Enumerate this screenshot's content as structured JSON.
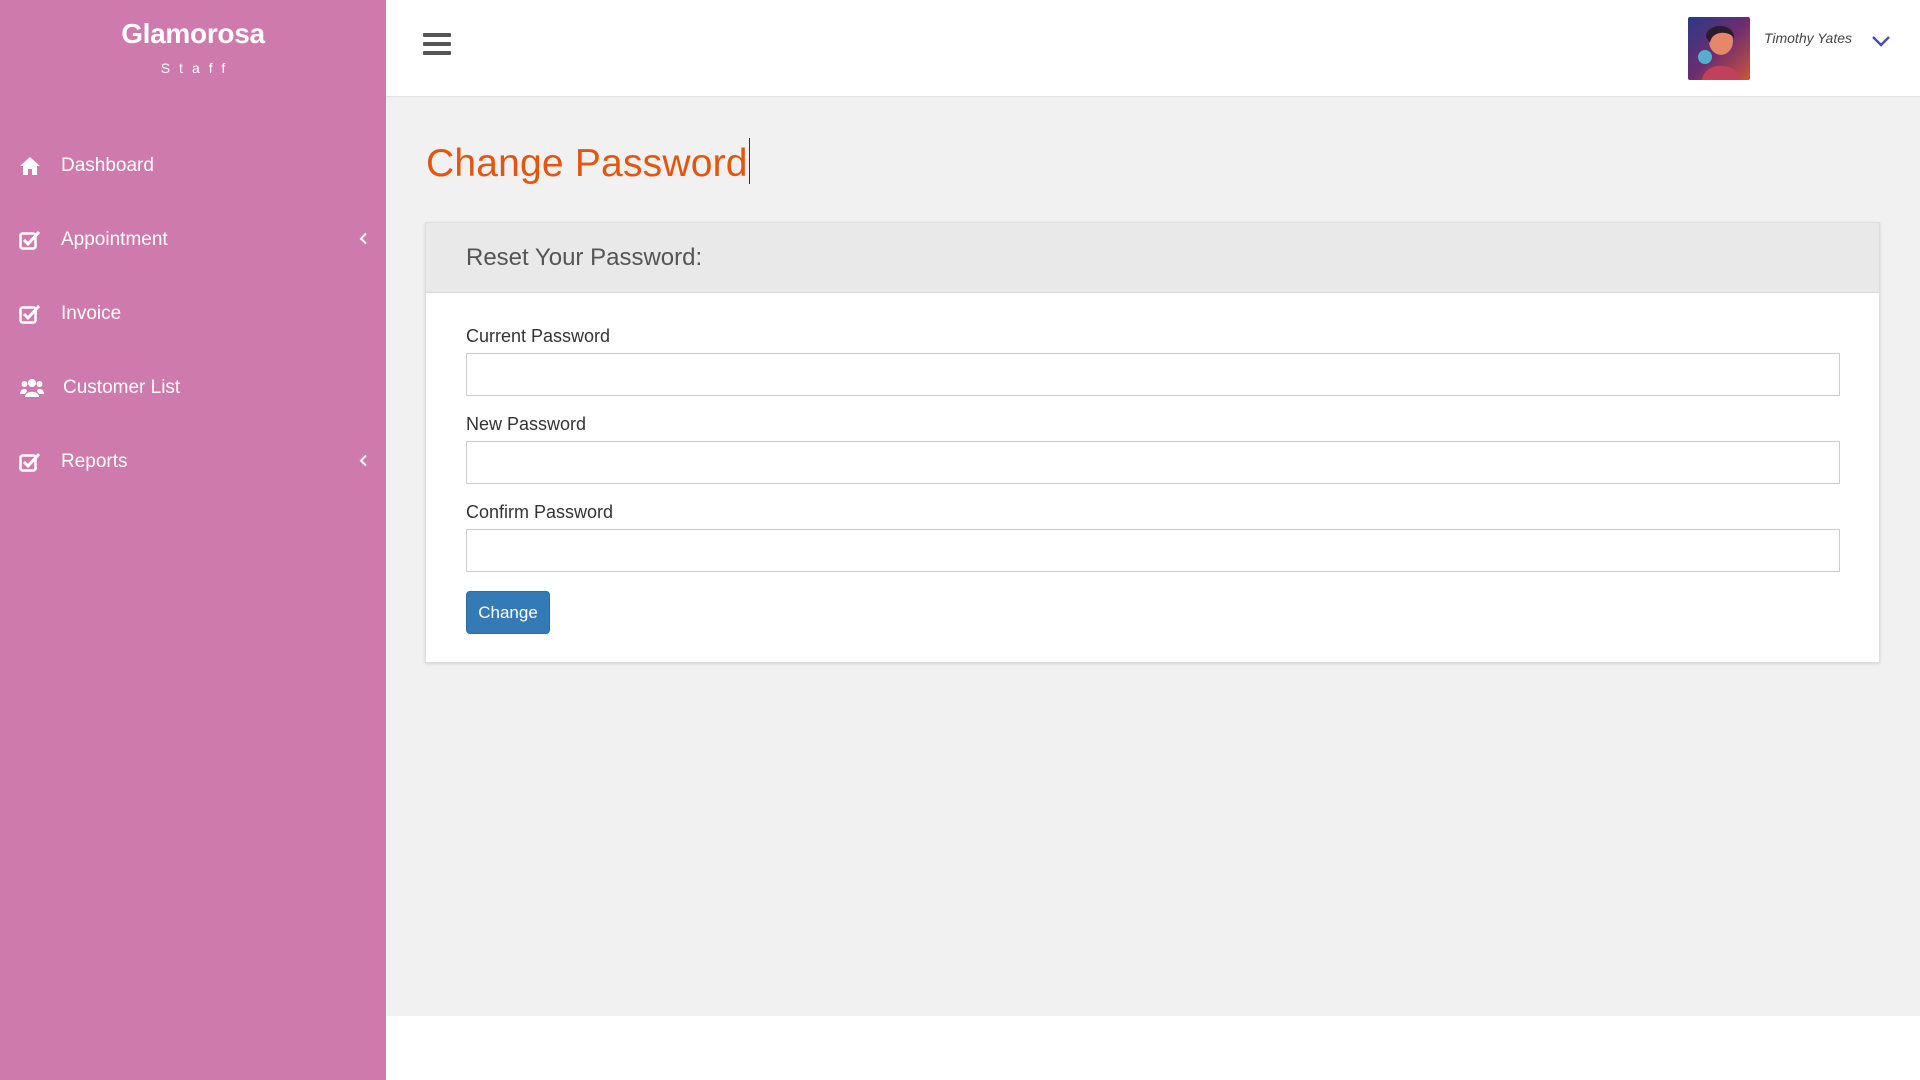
{
  "brand": {
    "name": "Glamorosa",
    "subtitle": "Staff"
  },
  "sidebar": {
    "bg_color": "#ce7aad",
    "items": [
      {
        "label": "Dashboard",
        "icon": "home-icon",
        "has_submenu": false
      },
      {
        "label": "Appointment",
        "icon": "check-square-icon",
        "has_submenu": true
      },
      {
        "label": "Invoice",
        "icon": "check-square-icon",
        "has_submenu": false
      },
      {
        "label": "Customer List",
        "icon": "users-icon",
        "has_submenu": false
      },
      {
        "label": "Reports",
        "icon": "check-square-icon",
        "has_submenu": true
      }
    ]
  },
  "topbar": {
    "menu_icon": "hamburger-icon",
    "user_name": "Timothy Yates",
    "user_menu_icon": "chevron-down-icon"
  },
  "page": {
    "title": "Change Password",
    "title_color": "#e4560f"
  },
  "form": {
    "heading": "Reset Your Password:",
    "fields": [
      {
        "label": "Current Password",
        "value": ""
      },
      {
        "label": "New Password",
        "value": ""
      },
      {
        "label": "Confirm Password",
        "value": ""
      }
    ],
    "submit_label": "Change",
    "submit_color": "#337ab7"
  }
}
